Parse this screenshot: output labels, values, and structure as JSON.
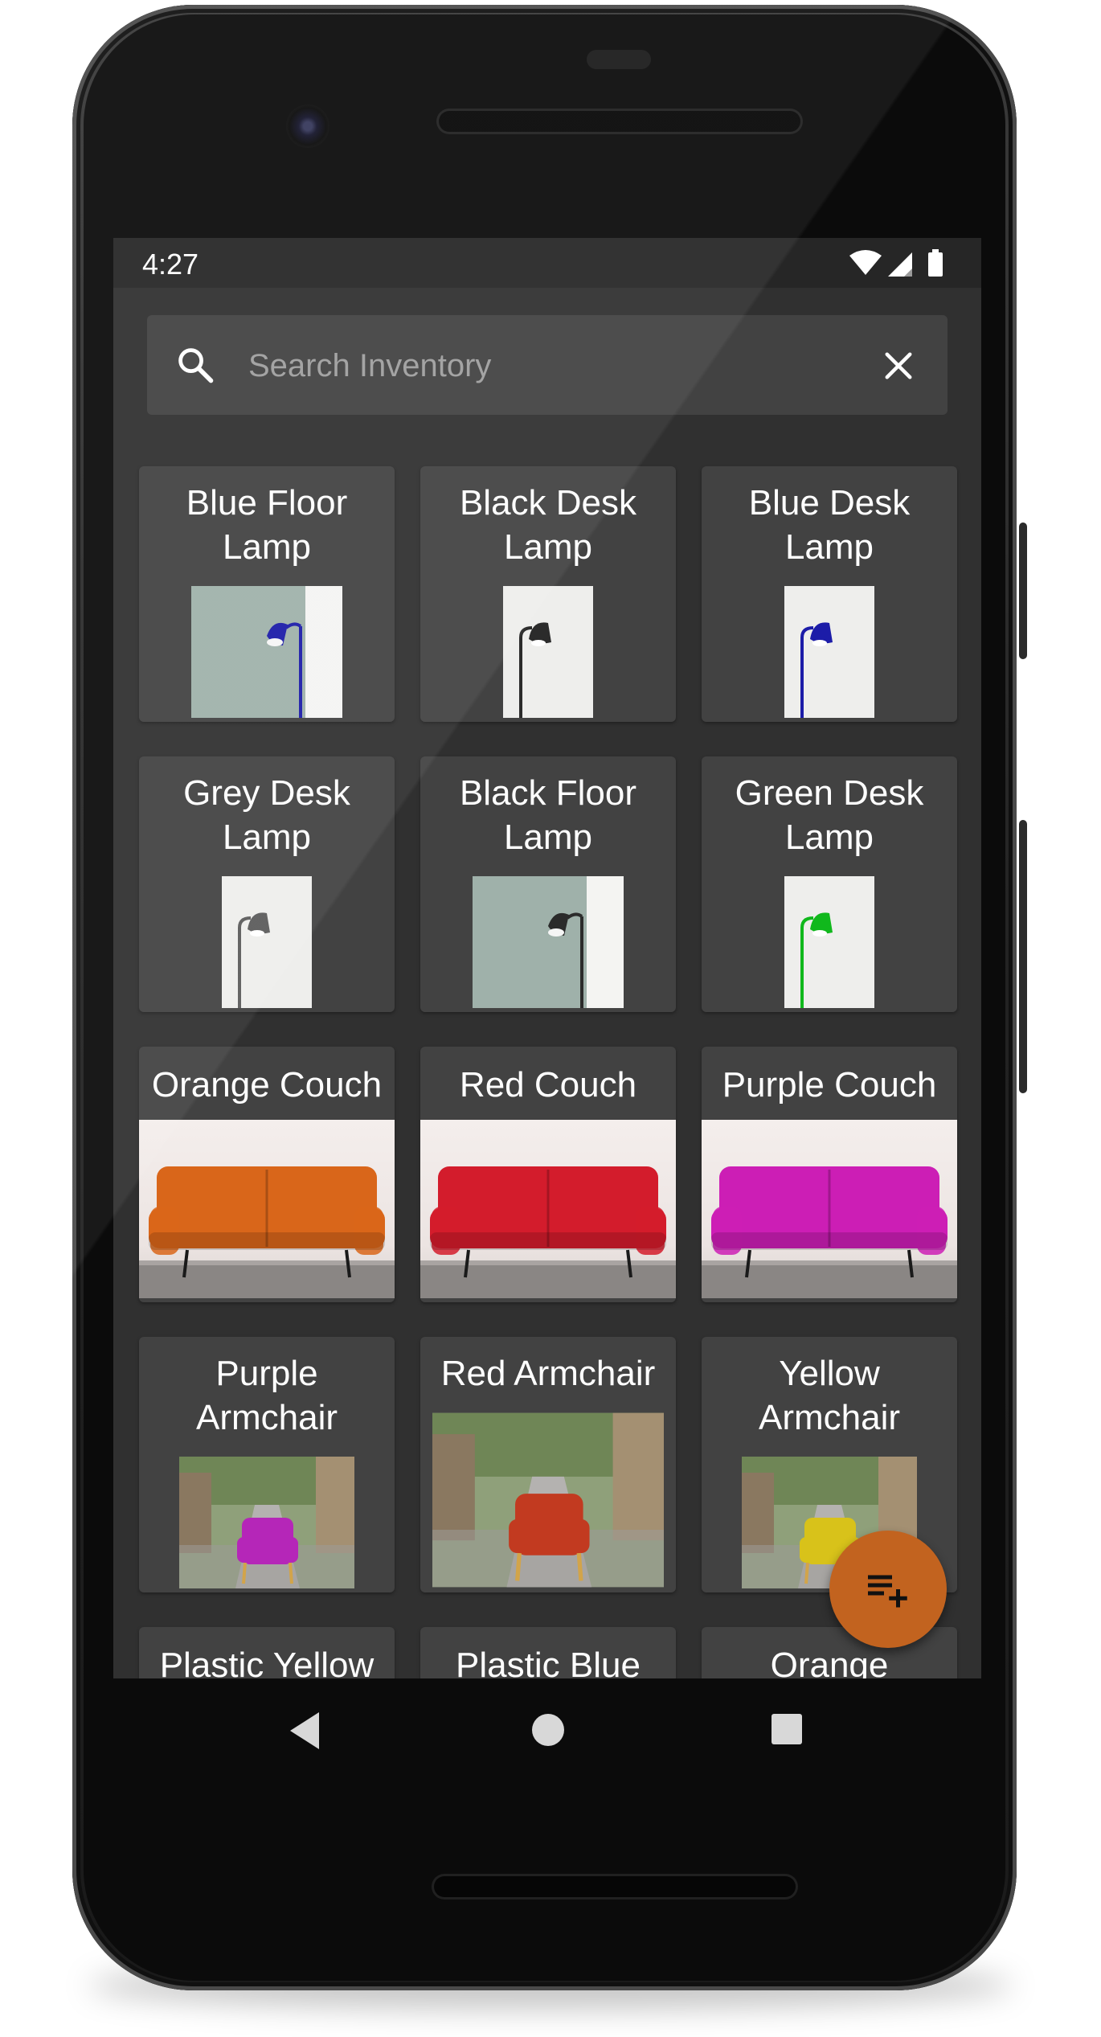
{
  "status_bar": {
    "time": "4:27",
    "icons": [
      "wifi-icon",
      "cell-signal-icon",
      "battery-icon"
    ]
  },
  "search": {
    "placeholder": "Search Inventory",
    "value": ""
  },
  "inventory": [
    {
      "name": "Blue Floor Lamp",
      "image": "floor-lamp",
      "color": "#1c1ca8"
    },
    {
      "name": "Black Desk Lamp",
      "image": "desk-lamp",
      "color": "#2b2b2b"
    },
    {
      "name": "Blue Desk Lamp",
      "image": "desk-lamp",
      "color": "#1c1ca8"
    },
    {
      "name": "Grey Desk Lamp",
      "image": "desk-lamp",
      "color": "#5b5b5b"
    },
    {
      "name": "Black Floor Lamp",
      "image": "floor-lamp",
      "color": "#2b2b2b"
    },
    {
      "name": "Green Desk Lamp",
      "image": "desk-lamp",
      "color": "#10b81c"
    },
    {
      "name": "Orange Couch",
      "image": "couch",
      "color": "#d9661a"
    },
    {
      "name": "Red Couch",
      "image": "couch",
      "color": "#d31c2c"
    },
    {
      "name": "Purple Couch",
      "image": "couch",
      "color": "#cc1eb5"
    },
    {
      "name": "Purple Armchair",
      "image": "armchair",
      "color": "#b526b8"
    },
    {
      "name": "Red Armchair",
      "image": "armchair",
      "color": "#c23a20"
    },
    {
      "name": "Yellow Armchair",
      "image": "armchair",
      "color": "#d8c21a"
    },
    {
      "name": "Plastic Yellow",
      "image": "partial",
      "color": "#d8c21a"
    },
    {
      "name": "Plastic Blue",
      "image": "partial",
      "color": "#1c6fd1"
    },
    {
      "name": "Orange",
      "image": "partial",
      "color": "#d9661a"
    }
  ],
  "fab": {
    "icon": "playlist-add-icon",
    "color": "#c2631f"
  },
  "nav": {
    "buttons": [
      "back-icon",
      "home-icon",
      "recents-icon"
    ]
  }
}
